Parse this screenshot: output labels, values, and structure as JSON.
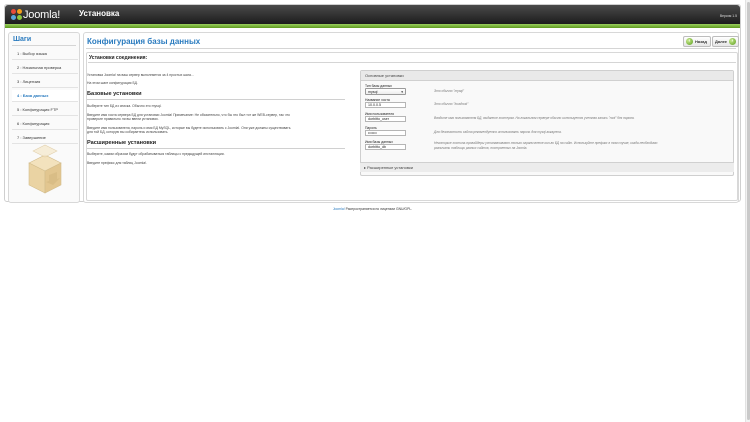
{
  "header": {
    "logo_text": "Joomla",
    "logo_excl": "!",
    "title": "Установка",
    "version": "Версия 1.5"
  },
  "steps": {
    "title": "Шаги",
    "items": [
      {
        "label": "1 : Выбор языка",
        "active": false
      },
      {
        "label": "2 : Начальная проверка",
        "active": false
      },
      {
        "label": "3 : Лицензия",
        "active": false
      },
      {
        "label": "4 : База данных",
        "active": true
      },
      {
        "label": "5 : Конфигурация FTP",
        "active": false
      },
      {
        "label": "6 : Конфигурация",
        "active": false
      },
      {
        "label": "7 : Завершение",
        "active": false
      }
    ]
  },
  "main": {
    "title": "Конфигурация базы данных",
    "back_label": "Назад",
    "next_label": "Далее",
    "panel_title": "Установки соединения:",
    "intro1": "Установка Joomla! на ваш сервер выполняется за 4 простых шага...",
    "intro2": "На этом шаге конфигурация БД.",
    "basic_heading": "Базовые установки",
    "basic1": "Выберите тип БД из списка. Обычно это mysql.",
    "basic2a": "Введите имя хоста сервера БД для установки Joomla! Примечание: Не обязательно, что бы это был тот же WEB-сервер, так что",
    "basic2b": "проверьте правильно ли вы ввели установки.",
    "basic3a": "Введите имя пользователя, пароль и имя БД MySQL, которые вы будете использовать с Joomla!. Они уже должны существовать",
    "basic3b": "для той БД, которую вы собираетесь использовать.",
    "adv_heading": "Расширенные установки",
    "adv1": "Выберите, каким образом будут обрабатываться таблицы с предыдущей инсталляции.",
    "adv2": "Введите префикс для таблиц Joomla!."
  },
  "form": {
    "basic_legend": "Основные установки",
    "dbtype_label": "Тип базы данных",
    "dbtype_value": "mysql",
    "dbtype_hint": "Это обычно \"mysql\"",
    "host_label": "Название хоста",
    "host_value": "10.0.0.5",
    "host_hint": "Это обычно \"localhost\"",
    "user_label": "Имя пользователя",
    "user_value": "dorbitto_user",
    "user_hint": "Вводите имя пользователя БД, выданное хостером. На локальном сервере обычно используется учетная запись \"root\" без пароля.",
    "pass_label": "Пароль",
    "pass_value": "•••••••",
    "pass_hint": "Для безопасности сайта рекомендуется использовать пароль для mysql аккаунта.",
    "dbname_label": "Имя базы данных",
    "dbname_value": "dorbitto_db",
    "dbname_hint_a": "Некоторые хостинг-провайдеры устанавливают только ограниченное кол-во БД на сайт. Используйте префикс в том случае, когда необходимо",
    "dbname_hint_b": "различать таблицы разных сайтов, построенных на Joomla.",
    "adv_legend": "Расширенные установки"
  },
  "footer": {
    "link": "Joomla!",
    "text": " Распространяется по лицензии GNU/GPL."
  },
  "colors": {
    "accent": "#2a7bbf",
    "green_bar": "#7fbf3a",
    "header_dark": "#2a2a2a"
  }
}
